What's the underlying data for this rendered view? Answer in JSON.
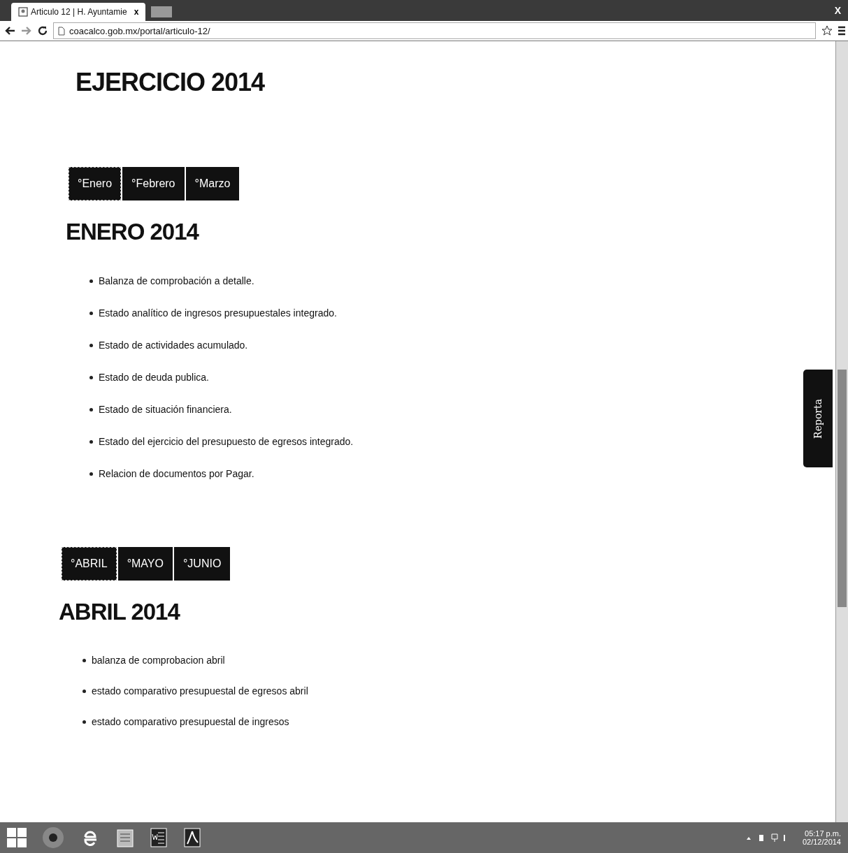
{
  "browser": {
    "tab_title": "Articulo 12 | H. Ayuntamie",
    "tab_close": "x",
    "window_close": "X",
    "url": "coacalco.gob.mx/portal/articulo-12/"
  },
  "page": {
    "title": "EJERCICIO 2014",
    "sections": [
      {
        "tabs": [
          {
            "label": "°Enero",
            "selected": true
          },
          {
            "label": "°Febrero",
            "selected": false
          },
          {
            "label": "°Marzo",
            "selected": false
          }
        ],
        "heading": "ENERO 2014",
        "items": [
          "Balanza de comprobación a detalle.",
          "Estado analítico de ingresos presupuestales integrado.",
          "Estado de actividades acumulado.",
          "Estado de deuda publica.",
          "Estado de situación financiera.",
          "Estado del ejercicio del presupuesto de egresos integrado.",
          "Relacion de documentos por Pagar."
        ]
      },
      {
        "tabs": [
          {
            "label": "°ABRIL",
            "selected": true
          },
          {
            "label": "°MAYO",
            "selected": false
          },
          {
            "label": "°JUNIO",
            "selected": false
          }
        ],
        "heading": "ABRIL 2014",
        "items": [
          "balanza de comprobacion abril",
          "estado comparativo presupuestal de egresos abril",
          "estado comparativo presupuestal de ingresos"
        ]
      }
    ],
    "side_tab": "Reporta"
  },
  "taskbar": {
    "time": "05:17 p.m.",
    "date": "02/12/2014"
  }
}
